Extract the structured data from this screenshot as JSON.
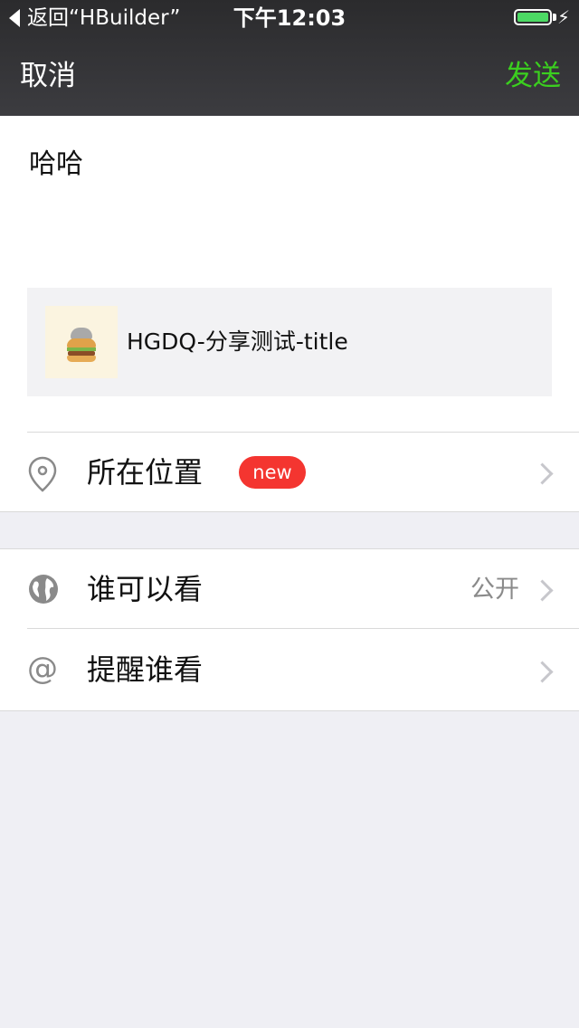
{
  "status_bar": {
    "back_label": "返回“HBuilder”",
    "time": "下午12:03",
    "battery_icon": "battery-full-icon",
    "charging_icon": "bolt-icon"
  },
  "nav": {
    "cancel_label": "取消",
    "send_label": "发送"
  },
  "compose": {
    "text": "哈哈",
    "share_card": {
      "title": "HGDQ-分享测试-title",
      "thumbnail": "burger-cat-image"
    }
  },
  "rows": {
    "location": {
      "label": "所在位置",
      "badge": "new",
      "icon": "location-pin-icon"
    },
    "visibility": {
      "label": "谁可以看",
      "value": "公开",
      "icon": "globe-icon"
    },
    "mention": {
      "label": "提醒谁看",
      "icon": "at-icon"
    }
  },
  "colors": {
    "accent": "#3bcf1f",
    "badge": "#f43530",
    "background": "#efeff4"
  }
}
